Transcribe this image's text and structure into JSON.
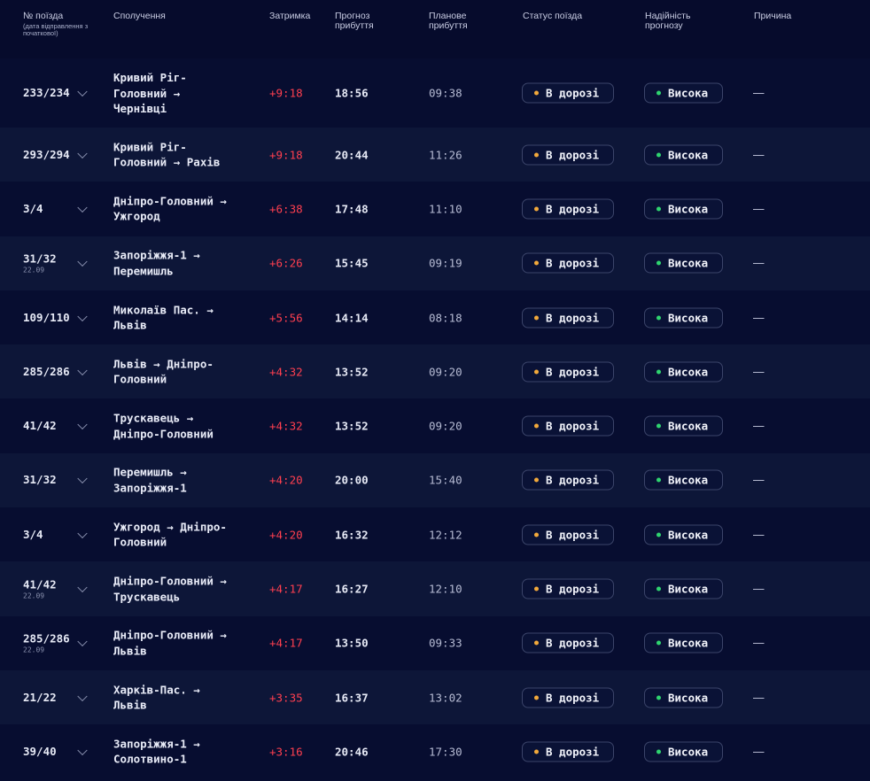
{
  "header": {
    "num": "№ поїзда",
    "num_sub": "(дата відправлення з початкової)",
    "route": "Сполучення",
    "delay": "Затримка",
    "forecast": "Прогноз прибуття",
    "planned": "Планове прибуття",
    "status": "Статус поїзда",
    "reliability": "Надійність прогнозу",
    "reason": "Причина"
  },
  "colors": {
    "delay": "#ff3f4f",
    "status_dot": "#f2a93b",
    "reliability_dot": "#2fd46f",
    "background": "#070d30"
  },
  "rows": [
    {
      "num": "233/234",
      "date": "",
      "route": "Кривий Ріг-\nГоловний →\nЧернівці",
      "delay": "+9:18",
      "forecast": "18:56",
      "planned": "09:38",
      "status": "В дорозі",
      "reliability": "Висока",
      "reason": "—"
    },
    {
      "num": "293/294",
      "date": "",
      "route": "Кривий Ріг-\nГоловний →  Рахів",
      "delay": "+9:18",
      "forecast": "20:44",
      "planned": "11:26",
      "status": "В дорозі",
      "reliability": "Висока",
      "reason": "—"
    },
    {
      "num": "3/4",
      "date": "",
      "route": "Дніпро-Головний →\nУжгород",
      "delay": "+6:38",
      "forecast": "17:48",
      "planned": "11:10",
      "status": "В дорозі",
      "reliability": "Висока",
      "reason": "—"
    },
    {
      "num": "31/32",
      "date": "22.09",
      "route": "Запоріжжя-1 →\nПеремишль",
      "delay": "+6:26",
      "forecast": "15:45",
      "planned": "09:19",
      "status": "В дорозі",
      "reliability": "Висока",
      "reason": "—"
    },
    {
      "num": "109/110",
      "date": "",
      "route": "Миколаїв Пас. →\nЛьвів",
      "delay": "+5:56",
      "forecast": "14:14",
      "planned": "08:18",
      "status": "В дорозі",
      "reliability": "Висока",
      "reason": "—"
    },
    {
      "num": "285/286",
      "date": "",
      "route": "Львів →  Дніпро-\nГоловний",
      "delay": "+4:32",
      "forecast": "13:52",
      "planned": "09:20",
      "status": "В дорозі",
      "reliability": "Висока",
      "reason": "—"
    },
    {
      "num": "41/42",
      "date": "",
      "route": "Трускавець →\nДніпро-Головний",
      "delay": "+4:32",
      "forecast": "13:52",
      "planned": "09:20",
      "status": "В дорозі",
      "reliability": "Висока",
      "reason": "—"
    },
    {
      "num": "31/32",
      "date": "",
      "route": "Перемишль →\nЗапоріжжя-1",
      "delay": "+4:20",
      "forecast": "20:00",
      "planned": "15:40",
      "status": "В дорозі",
      "reliability": "Висока",
      "reason": "—"
    },
    {
      "num": "3/4",
      "date": "",
      "route": "Ужгород →  Дніпро-\nГоловний",
      "delay": "+4:20",
      "forecast": "16:32",
      "planned": "12:12",
      "status": "В дорозі",
      "reliability": "Висока",
      "reason": "—"
    },
    {
      "num": "41/42",
      "date": "22.09",
      "route": "Дніпро-Головний →\nТрускавець",
      "delay": "+4:17",
      "forecast": "16:27",
      "planned": "12:10",
      "status": "В дорозі",
      "reliability": "Висока",
      "reason": "—"
    },
    {
      "num": "285/286",
      "date": "22.09",
      "route": "Дніпро-Головний →\nЛьвів",
      "delay": "+4:17",
      "forecast": "13:50",
      "planned": "09:33",
      "status": "В дорозі",
      "reliability": "Висока",
      "reason": "—"
    },
    {
      "num": "21/22",
      "date": "",
      "route": "Харків-Пас. →\nЛьвів",
      "delay": "+3:35",
      "forecast": "16:37",
      "planned": "13:02",
      "status": "В дорозі",
      "reliability": "Висока",
      "reason": "—"
    },
    {
      "num": "39/40",
      "date": "",
      "route": "Запоріжжя-1 →\nСолотвино-1",
      "delay": "+3:16",
      "forecast": "20:46",
      "planned": "17:30",
      "status": "В дорозі",
      "reliability": "Висока",
      "reason": "—"
    }
  ]
}
